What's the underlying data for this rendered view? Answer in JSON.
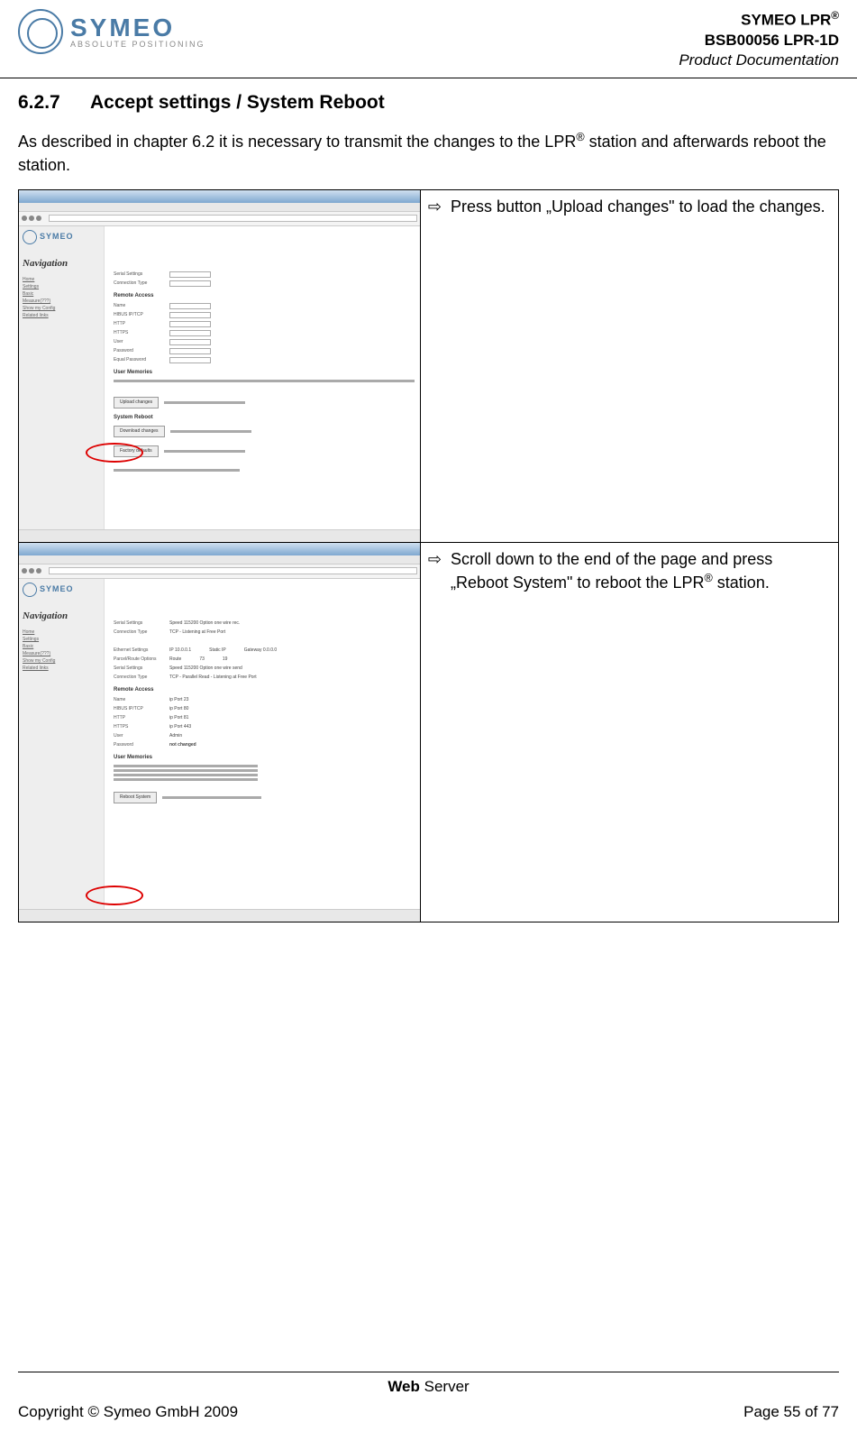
{
  "header": {
    "logo_text": "SYMEO",
    "logo_sub": "ABSOLUTE POSITIONING",
    "line1_prefix": "SYMEO LPR",
    "line1_sup": "®",
    "line2": "BSB00056 LPR-1D",
    "line3": "Product Documentation"
  },
  "section": {
    "number": "6.2.7",
    "title": "Accept settings / System Reboot"
  },
  "intro": {
    "text_a": "As described in chapter 6.2 it is necessary to transmit the changes to the LPR",
    "sup": "®",
    "text_b": " station and afterwards reboot the station."
  },
  "steps": [
    {
      "text_a": "Press  button „Upload changes\" to load the changes.",
      "sup": "",
      "text_b": ""
    },
    {
      "text_a": "Scroll down to the end of the page and press „Reboot System\" to reboot the LPR",
      "sup": "®",
      "text_b": " station."
    }
  ],
  "screenshot": {
    "nav_heading": "Navigation",
    "nav_items": [
      "Home",
      "Settings",
      "Basic",
      "Measure(???)",
      "Show my Config",
      "Related links"
    ],
    "fields1": [
      "Serial Settings",
      "Connection Type"
    ],
    "remote_heading": "Remote Access",
    "remote_fields": [
      "Name",
      "HIBUS IP/TCP",
      "HTTP",
      "HTTPS",
      "User",
      "Password",
      "Equal Password"
    ],
    "miss_heading": "User Memories",
    "btn_upload": "Upload changes",
    "btn_more1": "Download changes",
    "sysreboot_heading": "System Reboot",
    "btn_reboot": "Reboot System",
    "btn_factory": "Factory defaults",
    "vals2_head": [
      "Serial Settings",
      "Connection Type"
    ],
    "vals2_head2": [
      "Ethernet Settings",
      "Parcel/Route Options",
      "Serial Settings",
      "Connection Type"
    ],
    "remote_vals": [
      "ip Port 23",
      "ip Port 80",
      "ip Port 81",
      "ip Port 443",
      "Admin",
      "not changed"
    ]
  },
  "footer": {
    "center_bold": "Web",
    "center_rest": " Server",
    "copyright": "Copyright © Symeo GmbH 2009",
    "page": "Page 55 of 77"
  }
}
